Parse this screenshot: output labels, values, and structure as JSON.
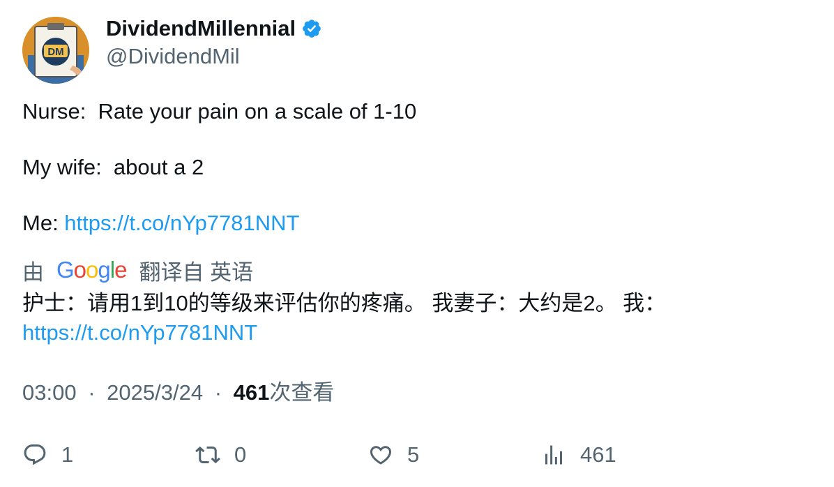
{
  "author": {
    "display_name": "DividendMillennial",
    "handle": "@DividendMil",
    "verified": true,
    "avatar_text": "DM",
    "verified_color": "#1d9bf0"
  },
  "tweet": {
    "lines": [
      "Nurse:  Rate your pain on a scale of 1-10",
      "My wife:  about a 2",
      "Me: "
    ],
    "link": "https://t.co/nYp7781NNT"
  },
  "translation": {
    "prefix": "由",
    "provider": "Google",
    "suffix": "翻译自 英语",
    "text": "护士：请用1到10的等级来评估你的疼痛。 我妻子：大约是2。 我：",
    "link": "https://t.co/nYp7781NNT"
  },
  "meta": {
    "time": "03:00",
    "separator": "·",
    "date": "2025/3/24",
    "views_count": "461",
    "views_label": "次查看"
  },
  "actions": {
    "reply": {
      "icon": "reply-icon",
      "count": "1"
    },
    "retweet": {
      "icon": "retweet-icon",
      "count": "0"
    },
    "like": {
      "icon": "heart-icon",
      "count": "5"
    },
    "views": {
      "icon": "analytics-icon",
      "count": "461"
    }
  }
}
